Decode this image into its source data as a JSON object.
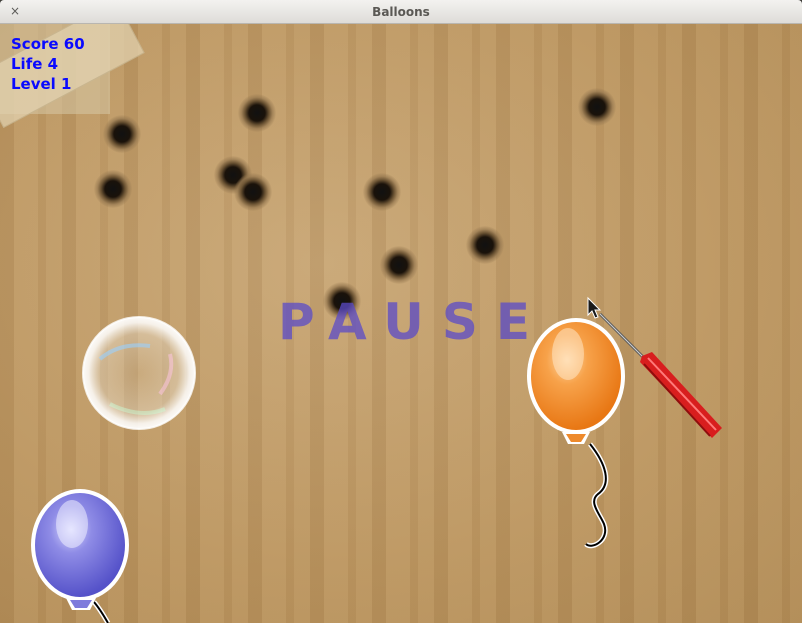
{
  "window": {
    "title": "Balloons",
    "close_glyph": "×"
  },
  "hud": {
    "score": "Score 60",
    "life": "Life 4",
    "level": "Level 1",
    "color": "#0a0aff"
  },
  "overlay": {
    "pause_text": "PAUSE",
    "pause_color": "#5b4bc8"
  },
  "balloons": [
    {
      "color": "orange",
      "fill": "#f3902b"
    },
    {
      "color": "blue",
      "fill": "#7b78db"
    }
  ],
  "icons": [
    "close-icon",
    "bullet-hole-icon",
    "soap-bubble-icon",
    "balloon-icon",
    "screwdriver-icon",
    "mouse-cursor-icon"
  ],
  "colors": {
    "cardboard": "#bb9560",
    "screwdriver_handle": "#d81e1e"
  }
}
